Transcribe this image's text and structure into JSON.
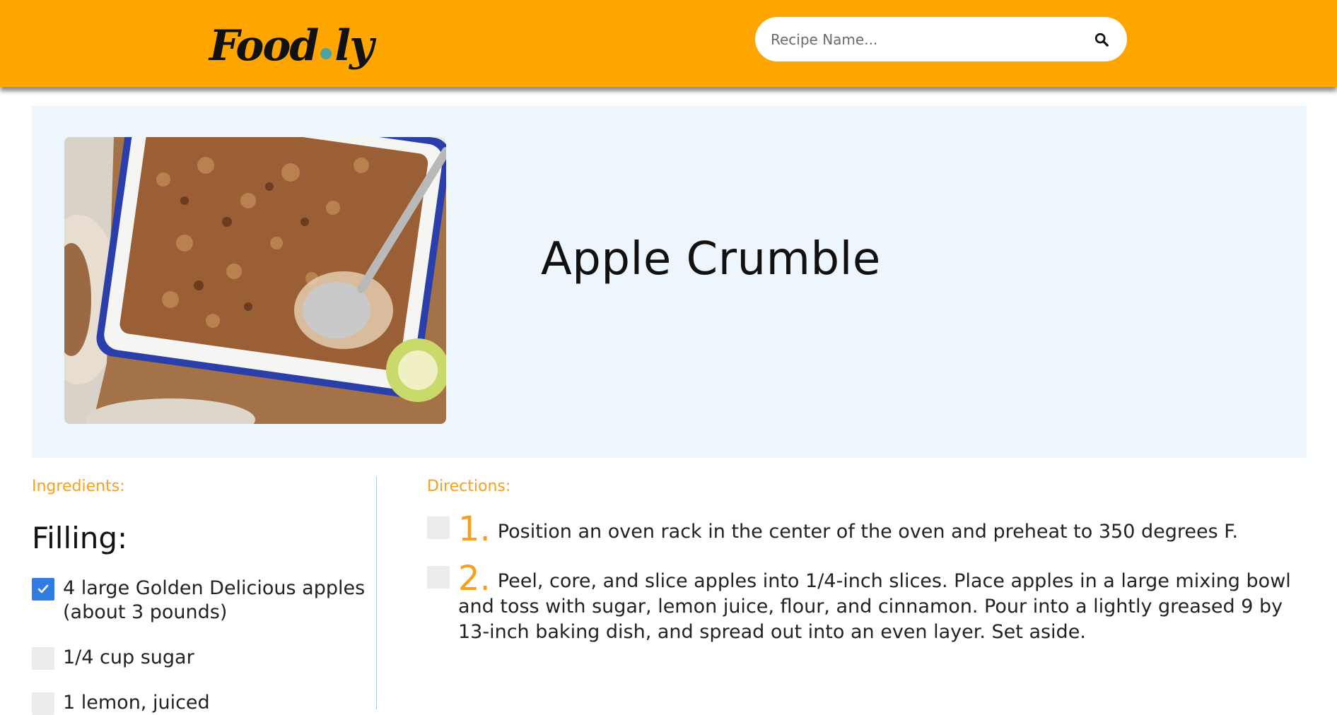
{
  "header": {
    "logo_left": "Food",
    "logo_right": "ly",
    "search_placeholder": "Recipe Name..."
  },
  "recipe": {
    "title": "Apple Crumble",
    "image_alt": "Apple crumble in a baking dish with a spoon"
  },
  "ingredients": {
    "label": "Ingredients:",
    "section_title": "Filling:",
    "items": [
      {
        "text": "4 large Golden Delicious apples (about 3 pounds)",
        "checked": true
      },
      {
        "text": "1/4 cup sugar",
        "checked": false
      },
      {
        "text": "1 lemon, juiced",
        "checked": false
      }
    ]
  },
  "directions": {
    "label": "Directions:",
    "steps": [
      {
        "number": "1.",
        "text": "Position an oven rack in the center of the oven and preheat to 350 degrees F."
      },
      {
        "number": "2.",
        "text": "Peel, core, and slice apples into 1/4-inch slices. Place apples in a large mixing bowl and toss with sugar, lemon juice, flour, and cinnamon. Pour into a lightly greased 9 by 13-inch baking dish, and spread out into an even layer. Set aside."
      }
    ]
  },
  "colors": {
    "header_bg": "#ffa500",
    "accent": "#f5a01e",
    "hero_bg": "#eef6fd",
    "checkbox_on": "#2f7de1",
    "logo_dot": "#4aa3a6"
  }
}
